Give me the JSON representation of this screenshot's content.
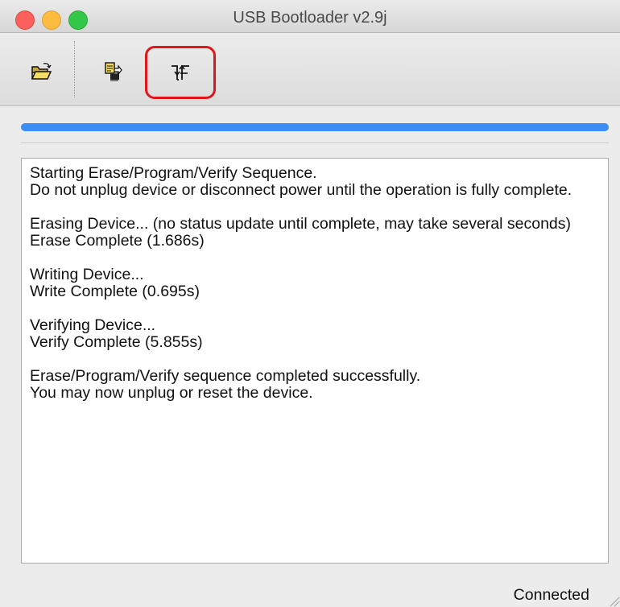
{
  "window": {
    "title": "USB Bootloader v2.9j"
  },
  "toolbar": {
    "buttons": [
      {
        "icon": "open-folder-icon"
      },
      {
        "icon": "program-device-icon"
      },
      {
        "icon": "reset-device-icon",
        "highlighted": true
      }
    ]
  },
  "progress": {
    "value": 100
  },
  "log": {
    "lines": [
      "Starting Erase/Program/Verify Sequence.",
      "Do not unplug device or disconnect power until the operation is fully complete.",
      "",
      "Erasing Device... (no status update until complete, may take several seconds)",
      "Erase Complete (1.686s)",
      "",
      "Writing Device...",
      "Write Complete (0.695s)",
      "",
      "Verifying Device...",
      "Verify Complete (5.855s)",
      "",
      "Erase/Program/Verify sequence completed successfully.",
      "You may now unplug or reset the device."
    ]
  },
  "statusbar": {
    "status": "Connected"
  },
  "colors": {
    "progress": "#3a8ef5",
    "highlight": "#e0161b",
    "close": "#fc605c",
    "minimize": "#fdbc40",
    "maximize": "#34c84a"
  }
}
